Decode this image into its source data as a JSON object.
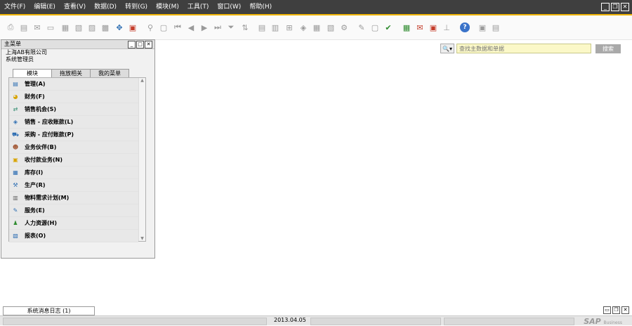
{
  "menubar": {
    "items": [
      "文件(F)",
      "编辑(E)",
      "查看(V)",
      "数据(D)",
      "转到(G)",
      "模块(M)",
      "工具(T)",
      "窗口(W)",
      "帮助(H)"
    ]
  },
  "window_controls": {
    "minimize": "_",
    "restore": "❐",
    "close": "✕"
  },
  "search": {
    "placeholder": "查找主数据和单据",
    "button_label": "搜索",
    "dropdown_label": "🔍▾"
  },
  "main_menu": {
    "title": "主菜单",
    "controls": {
      "min": "_",
      "max": "□",
      "close": "✕"
    },
    "company": "上海AB有限公司",
    "user": "系统管理员",
    "tabs": [
      "模块",
      "拖放相关",
      "我的菜单"
    ],
    "active_tab": 0,
    "modules": [
      {
        "label": "管理(A)",
        "icon": "admin-icon"
      },
      {
        "label": "财务(F)",
        "icon": "finance-icon"
      },
      {
        "label": "销售机会(S)",
        "icon": "opportunity-icon"
      },
      {
        "label": "销售 - 应收账款(L)",
        "icon": "sales-icon"
      },
      {
        "label": "采购 - 应付账款(P)",
        "icon": "purchase-cart-icon"
      },
      {
        "label": "业务伙伴(B)",
        "icon": "partners-icon"
      },
      {
        "label": "收付款业务(N)",
        "icon": "payment-icon"
      },
      {
        "label": "库存(I)",
        "icon": "inventory-icon"
      },
      {
        "label": "生产(R)",
        "icon": "production-icon"
      },
      {
        "label": "物料需求计划(M)",
        "icon": "mrp-icon"
      },
      {
        "label": "服务(E)",
        "icon": "service-icon"
      },
      {
        "label": "人力资源(H)",
        "icon": "hr-icon"
      },
      {
        "label": "报表(O)",
        "icon": "report-icon"
      }
    ]
  },
  "message_log": {
    "label": "系统消息日志 (1)"
  },
  "status": {
    "date": "2013.04.05"
  },
  "brand": {
    "logo": "SAP",
    "subtitle": "Business"
  },
  "colors": {
    "menubar": "#3f3f3f",
    "accent": "#f0b400",
    "search_bg": "#fbf8c8"
  }
}
